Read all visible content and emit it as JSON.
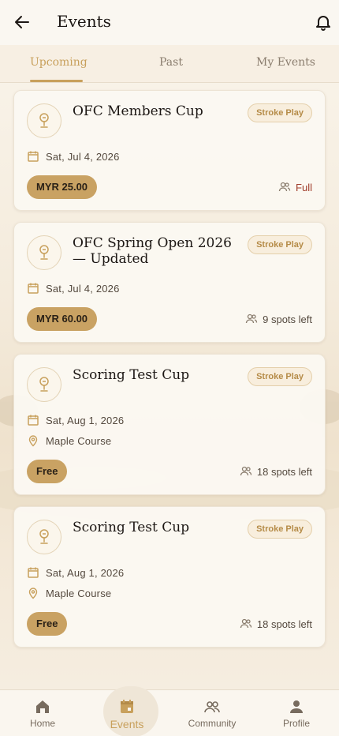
{
  "header": {
    "title": "Events"
  },
  "tabs": [
    {
      "label": "Upcoming",
      "active": true
    },
    {
      "label": "Past",
      "active": false
    },
    {
      "label": "My Events",
      "active": false
    }
  ],
  "events": [
    {
      "title": "OFC Members Cup",
      "format": "Stroke Play",
      "date": "Sat, Jul 4, 2026",
      "location": "",
      "price": "MYR 25.00",
      "availability": "Full",
      "is_full": true
    },
    {
      "title": "OFC Spring Open 2026 — Updated",
      "format": "Stroke Play",
      "date": "Sat, Jul 4, 2026",
      "location": "",
      "price": "MYR 60.00",
      "availability": "9 spots left",
      "is_full": false
    },
    {
      "title": "Scoring Test Cup",
      "format": "Stroke Play",
      "date": "Sat, Aug 1, 2026",
      "location": "Maple Course",
      "price": "Free",
      "availability": "18 spots left",
      "is_full": false
    },
    {
      "title": "Scoring Test Cup",
      "format": "Stroke Play",
      "date": "Sat, Aug 1, 2026",
      "location": "Maple Course",
      "price": "Free",
      "availability": "18 spots left",
      "is_full": false
    }
  ],
  "bottom_nav": [
    {
      "label": "Home",
      "icon": "home-icon",
      "active": false
    },
    {
      "label": "Events",
      "icon": "calendar-icon",
      "active": true
    },
    {
      "label": "Community",
      "icon": "community-icon",
      "active": false
    },
    {
      "label": "Profile",
      "icon": "profile-icon",
      "active": false
    }
  ],
  "colors": {
    "accent": "#c8a05c",
    "price_pill": "#c9a263",
    "full": "#a03d2b",
    "background": "#f6efe3"
  }
}
